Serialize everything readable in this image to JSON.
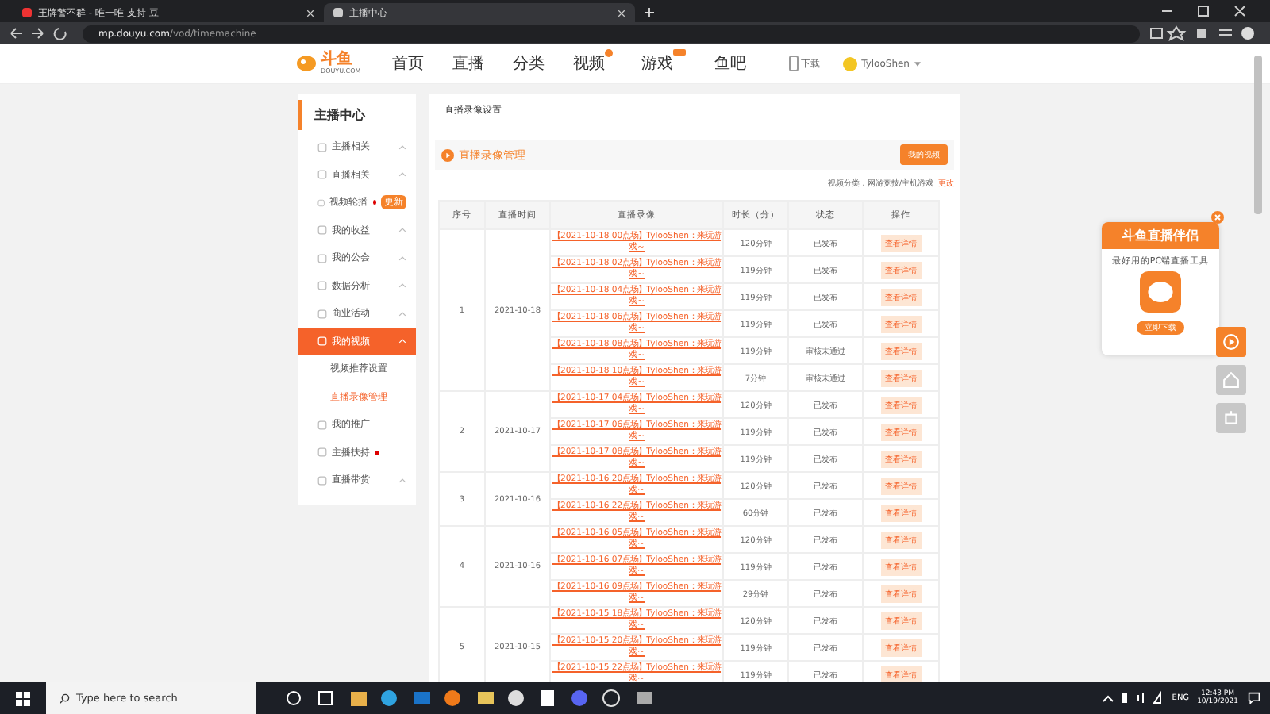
{
  "browser": {
    "tabs": [
      {
        "title": "王牌警不群 - 唯一唯 支持 豆",
        "selected": false
      },
      {
        "title": "主播中心",
        "selected": true
      }
    ],
    "url_host": "mp.douyu.com",
    "url_path": "/vod/timemachine"
  },
  "nav": {
    "logo": "斗鱼",
    "logo_sub": "DOUYU.COM",
    "items": [
      {
        "label": "首页",
        "dot": false,
        "tag": false
      },
      {
        "label": "直播",
        "dot": false,
        "tag": false
      },
      {
        "label": "分类",
        "dot": false,
        "tag": false
      },
      {
        "label": "视频",
        "dot": true,
        "tag": false
      },
      {
        "label": "游戏",
        "dot": false,
        "tag": true
      },
      {
        "label": "鱼吧",
        "dot": false,
        "tag": false
      }
    ],
    "download": "下载",
    "user": "TylooShen"
  },
  "sidebar": {
    "title": "主播中心",
    "items": [
      {
        "label": "主播相关",
        "expanded": false,
        "dot": false
      },
      {
        "label": "直播相关",
        "expanded": false,
        "dot": false
      },
      {
        "label": "视频轮播",
        "dot": true,
        "tag": "更新"
      },
      {
        "label": "我的收益",
        "expanded": false,
        "dot": false
      },
      {
        "label": "我的公会",
        "expanded": false,
        "dot": false
      },
      {
        "label": "数据分析",
        "expanded": false,
        "dot": false
      },
      {
        "label": "商业活动",
        "expanded": false,
        "dot": false
      },
      {
        "label": "我的视频",
        "expanded": true,
        "dot": false,
        "children": [
          {
            "label": "视频推荐设置",
            "selected": false
          },
          {
            "label": "直播录像管理",
            "selected": true
          }
        ]
      },
      {
        "label": "我的推广",
        "dot": false
      },
      {
        "label": "主播扶持",
        "dot": true
      },
      {
        "label": "直播带货",
        "expanded": false,
        "dot": false
      }
    ]
  },
  "page_title": "直播录像设置",
  "panel": {
    "title": "直播录像管理",
    "button": "我的视频"
  },
  "category": {
    "label": "视频分类：网游竞技/主机游戏",
    "link": "更改"
  },
  "table": {
    "columns": [
      "序号",
      "直播时间",
      "直播录像",
      "时长（分）",
      "状态",
      "操作"
    ],
    "groups": [
      {
        "index": "1",
        "date": "2021-10-18",
        "rows": [
          {
            "title": "【2021-10-18 00点场】TylooShen：来玩游戏～",
            "duration": "120分钟",
            "status": "已发布",
            "action": "查看详情"
          },
          {
            "title": "【2021-10-18 02点场】TylooShen：来玩游戏～",
            "duration": "119分钟",
            "status": "已发布",
            "action": "查看详情"
          },
          {
            "title": "【2021-10-18 04点场】TylooShen：来玩游戏～",
            "duration": "119分钟",
            "status": "已发布",
            "action": "查看详情"
          },
          {
            "title": "【2021-10-18 06点场】TylooShen：来玩游戏～",
            "duration": "119分钟",
            "status": "已发布",
            "action": "查看详情"
          },
          {
            "title": "【2021-10-18 08点场】TylooShen：来玩游戏～",
            "duration": "119分钟",
            "status": "审核未通过",
            "action": "查看详情"
          },
          {
            "title": "【2021-10-18 10点场】TylooShen：来玩游戏～",
            "duration": "7分钟",
            "status": "审核未通过",
            "action": "查看详情"
          }
        ]
      },
      {
        "index": "2",
        "date": "2021-10-17",
        "rows": [
          {
            "title": "【2021-10-17 04点场】TylooShen：来玩游戏～",
            "duration": "120分钟",
            "status": "已发布",
            "action": "查看详情"
          },
          {
            "title": "【2021-10-17 06点场】TylooShen：来玩游戏～",
            "duration": "119分钟",
            "status": "已发布",
            "action": "查看详情"
          },
          {
            "title": "【2021-10-17 08点场】TylooShen：来玩游戏～",
            "duration": "119分钟",
            "status": "已发布",
            "action": "查看详情"
          }
        ]
      },
      {
        "index": "3",
        "date": "2021-10-16",
        "rows": [
          {
            "title": "【2021-10-16 20点场】TylooShen：来玩游戏～",
            "duration": "120分钟",
            "status": "已发布",
            "action": "查看详情"
          },
          {
            "title": "【2021-10-16 22点场】TylooShen：来玩游戏～",
            "duration": "60分钟",
            "status": "已发布",
            "action": "查看详情"
          }
        ]
      },
      {
        "index": "4",
        "date": "2021-10-16",
        "rows": [
          {
            "title": "【2021-10-16 05点场】TylooShen：来玩游戏～",
            "duration": "120分钟",
            "status": "已发布",
            "action": "查看详情"
          },
          {
            "title": "【2021-10-16 07点场】TylooShen：来玩游戏～",
            "duration": "119分钟",
            "status": "已发布",
            "action": "查看详情"
          },
          {
            "title": "【2021-10-16 09点场】TylooShen：来玩游戏～",
            "duration": "29分钟",
            "status": "已发布",
            "action": "查看详情"
          }
        ]
      },
      {
        "index": "5",
        "date": "2021-10-15",
        "rows": [
          {
            "title": "【2021-10-15 18点场】TylooShen：来玩游戏～",
            "duration": "120分钟",
            "status": "已发布",
            "action": "查看详情"
          },
          {
            "title": "【2021-10-15 20点场】TylooShen：来玩游戏～",
            "duration": "119分钟",
            "status": "已发布",
            "action": "查看详情"
          },
          {
            "title": "【2021-10-15 22点场】TylooShen：来玩游戏～",
            "duration": "119分钟",
            "status": "已发布",
            "action": "查看详情"
          }
        ]
      }
    ]
  },
  "promo": {
    "title": "斗鱼直播伴侣",
    "subtitle": "最好用的PC端直播工具",
    "button": "立即下载"
  },
  "taskbar": {
    "search": "Type here to search",
    "lang": "ENG",
    "time": "12:43 PM",
    "date": "10/19/2021"
  }
}
